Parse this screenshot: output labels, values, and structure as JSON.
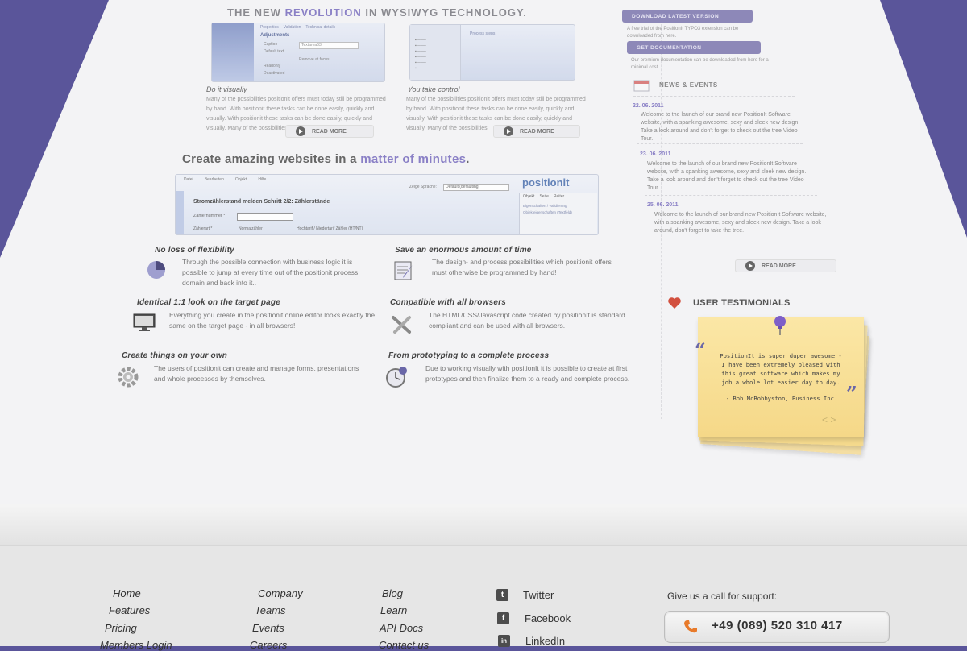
{
  "hero": {
    "title_part1": "THE NEW ",
    "title_accent": "REVOLUTION",
    "title_part2": " IN WYSIWYG TECHNOLOGY."
  },
  "cards": [
    {
      "caption": "Do it visually",
      "text": "Many of the possibilities positionit offers must today still be programmed by hand. With positionit these tasks can be done easily, quickly and visually. With positionit these tasks can be done easily, quickly and visually. Many of the possibilities.",
      "read_more": "READ MORE"
    },
    {
      "caption": "You take control",
      "text": "Many of the possibilities positionit offers must today still be programmed by hand. With positionit these tasks can be done easily, quickly and visually. With positionit these tasks can be done easily, quickly and visually. Many of the possibilities.",
      "read_more": "READ MORE"
    }
  ],
  "shot1": {
    "tabs": [
      "Properties",
      "Validation",
      "Technical details"
    ],
    "section": "Adjustments",
    "rows": [
      "Caption",
      "Default text",
      "Readonly",
      "Deactivated"
    ],
    "field_value": "Textarea63",
    "checkbox_label": "Remove at focus"
  },
  "shot2": {
    "panel_title": "Process steps"
  },
  "headline2": {
    "part1": "Create amazing websites in a ",
    "accent": "matter of minutes",
    "part2": "."
  },
  "shot3": {
    "menu": [
      "Datei",
      "Bearbeiten",
      "Objekt",
      "Hilfe"
    ],
    "language_label": "Zeige Sprache:",
    "language_value": "Default (defaulting)",
    "brand": "positionit",
    "form_title": "Stromzählerstand melden Schritt 2/2: Zählerstände",
    "field1": "Zählernummer *",
    "field2": "Zählerart *",
    "radio1": "Normalzähler",
    "radio2": "Hochtarif / Niedertarif Zähler (HT/NT)",
    "side_tabs": [
      "Objekt",
      "Seite",
      "Reiter"
    ],
    "side_rows": [
      "Eigenschaften / Validierung",
      "Objekteigenschaften (Textfeld)"
    ]
  },
  "features": [
    {
      "title": "No loss of flexibility",
      "text": "Through the possible connection with business logic it is possible to jump at every time out of the positionit process domain and back into it..",
      "icon": "pie-chart-icon"
    },
    {
      "title": "Save an enormous amount of time",
      "text": "The design- and process possibilities which positionit offers  must otherwise be programmed by hand!",
      "icon": "document-edit-icon"
    },
    {
      "title": "Identical 1:1 look on the target page",
      "text": "Everything you create in the positionit online editor looks exactly the same on the target page - in all browsers!",
      "icon": "monitor-icon"
    },
    {
      "title": "Compatible with all browsers",
      "text": "The HTML/CSS/Javascript code created by positionIt is standard compliant and can be used with all browsers.",
      "icon": "tools-icon"
    },
    {
      "title": "Create things on your own",
      "text": "The users of positionit can create and manage forms, presentations and whole processes by themselves.",
      "icon": "gear-icon"
    },
    {
      "title": "From prototyping to a complete process",
      "text": "Due to working visually with positionIt it is possible to create at first prototypes and then finalize them to a ready and complete process.",
      "icon": "clock-icon"
    }
  ],
  "sidebar": {
    "download_btn": "DOWNLOAD LATEST VERSION",
    "download_text": "A free trial of the PositionIt TYPO3 extension can be downloaded from here.",
    "docs_btn": "GET DOCUMENTATION",
    "docs_text": "Our premium documentation can be downloaded from here for a minimal cost.",
    "news_title": "NEWS & EVENTS",
    "news": [
      {
        "date": "22. 06. 2011",
        "text": "Welcome to the launch of our brand new PositionIt Software website, with a spanking awesome, sexy and sleek new design. Take a look around and don't forget to check out the tree Video Tour."
      },
      {
        "date": "23. 06. 2011",
        "text": "Welcome to the launch of our brand new PositionIt Software website, with a spanking awesome, sexy and sleek new design. Take a look around and don't forget to check out the tree Video Tour."
      },
      {
        "date": "25. 06. 2011",
        "text": "Welcome to the launch of our brand new PositionIt Software website, with a spanking awesome, sexy and sleek new design. Take a look around, don't forget to take the tree."
      }
    ],
    "news_read_more": "READ MORE",
    "testimonials_title": "USER TESTIMONIALS",
    "testimonial_text": "PositionIt is super duper awesome - I have been extremely pleased with this great software which makes my job a whole lot easier day to day.",
    "testimonial_author": "- Bob McBobbyston, Business Inc.",
    "open_quote": "“",
    "close_quote": "”",
    "prev": "<",
    "next": ">"
  },
  "footer": {
    "col1": [
      "Home",
      "Features",
      "Pricing",
      "Members Login"
    ],
    "col2": [
      "Company",
      "Teams",
      "Events",
      "Careers"
    ],
    "col3": [
      "Blog",
      "Learn",
      "API Docs",
      "Contact us"
    ],
    "social": [
      {
        "label": "Twitter",
        "icon": "twitter-icon",
        "glyph": "t"
      },
      {
        "label": "Facebook",
        "icon": "facebook-icon",
        "glyph": "f"
      },
      {
        "label": "LinkedIn",
        "icon": "linkedin-icon",
        "glyph": "in"
      }
    ],
    "support_label": "Give us a call for support:",
    "phone": "+49 (089) 520 310 417"
  },
  "colors": {
    "background": "#5a559a",
    "accent": "#8a80c6",
    "note": "#f7dc8f"
  }
}
